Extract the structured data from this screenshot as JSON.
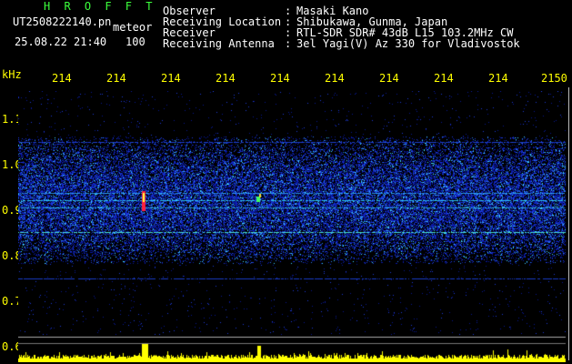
{
  "header": {
    "title": "H R O F F T",
    "filename": "UT2508222140.pn",
    "meteor_label": "meteor",
    "datetime": "25.08.22 21:40",
    "count": "100"
  },
  "info": [
    {
      "label": "Observer",
      "value": "Masaki Kano"
    },
    {
      "label": "Receiving Location",
      "value": "Shibukawa, Gunma, Japan"
    },
    {
      "label": "Receiver",
      "value": "RTL-SDR SDR# 43dB L15 103.2MHz CW"
    },
    {
      "label": "Receiving Antenna",
      "value": "3el Yagi(V) Az 330 for Vladivostok"
    }
  ],
  "separator": ":",
  "axis": {
    "unit": "kHz",
    "freq_ticks": [
      "214",
      "214",
      "214",
      "214",
      "214",
      "214",
      "214",
      "214",
      "214",
      "2150"
    ],
    "y_labels": [
      "1.1",
      "1.0",
      "0.9",
      "0.8",
      "0.7",
      "0.6"
    ]
  },
  "colors": {
    "background": "#000000",
    "title": "#3cff3c",
    "axis_text": "#ffff00",
    "header_text": "#ffffff",
    "spectrogram_low": "#0010a0",
    "spectrogram_high": "#ff3040",
    "meteor_echo": "#ffff00"
  }
}
